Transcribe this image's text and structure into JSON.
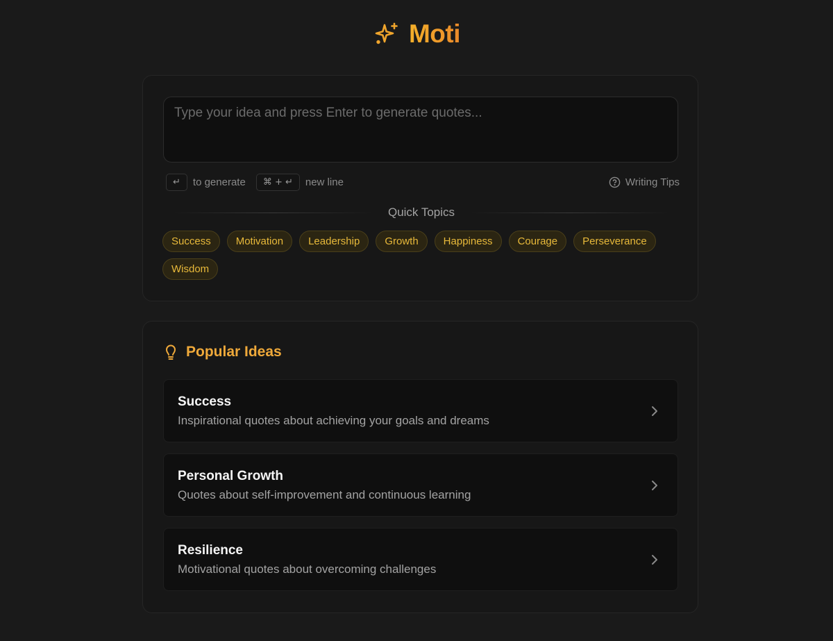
{
  "app": {
    "brand": "Moti",
    "logo_icon": "sparkles-icon",
    "accent_color": "#f0a52c"
  },
  "composer": {
    "placeholder": "Type your idea and press Enter to generate quotes...",
    "value": "",
    "hint_generate_key": "↵",
    "hint_generate_label": "to generate",
    "hint_newline_key": "⌘ + ↵",
    "hint_newline_label": "new line",
    "tips_icon": "help-circle-icon",
    "tips_label": "Writing Tips"
  },
  "quick_topics": {
    "label": "Quick Topics",
    "items": [
      "Success",
      "Motivation",
      "Leadership",
      "Growth",
      "Happiness",
      "Courage",
      "Perseverance",
      "Wisdom"
    ]
  },
  "popular_ideas": {
    "icon": "lightbulb-icon",
    "title": "Popular Ideas",
    "items": [
      {
        "title": "Success",
        "description": "Inspirational quotes about achieving your goals and dreams"
      },
      {
        "title": "Personal Growth",
        "description": "Quotes about self-improvement and continuous learning"
      },
      {
        "title": "Resilience",
        "description": "Motivational quotes about overcoming challenges"
      }
    ]
  }
}
